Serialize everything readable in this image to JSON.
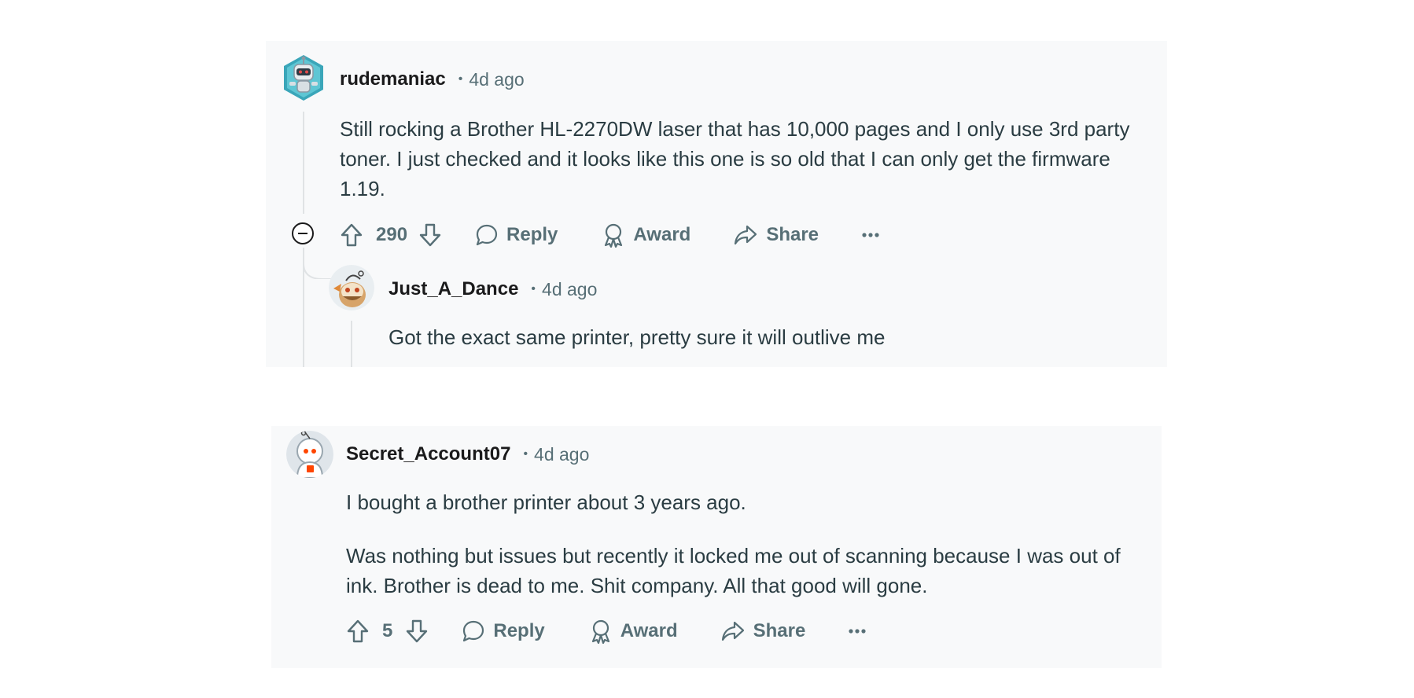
{
  "comments": [
    {
      "username": "rudemaniac",
      "separator": "•",
      "time": "4d ago",
      "body": [
        "Still rocking a Brother HL-2270DW laser that has 10,000 pages and I only use 3rd party toner. I just checked and it looks like this one is so old that I can only get the firmware 1.19."
      ],
      "score": "290",
      "actions": {
        "reply": "Reply",
        "award": "Award",
        "share": "Share"
      },
      "reply": {
        "username": "Just_A_Dance",
        "separator": "•",
        "time": "4d ago",
        "body": "Got the exact same printer, pretty sure it will outlive me"
      }
    },
    {
      "username": "Secret_Account07",
      "separator": "•",
      "time": "4d ago",
      "body": [
        "I bought a brother printer about 3 years ago.",
        "Was nothing but issues but recently it locked me out of scanning because I was out of ink. Brother is dead to me. Shit company. All that good will gone."
      ],
      "score": "5",
      "actions": {
        "reply": "Reply",
        "award": "Award",
        "share": "Share"
      }
    }
  ],
  "icons": {
    "upvote": "upvote-icon",
    "downvote": "downvote-icon",
    "reply": "speech-bubble-icon",
    "award": "award-ribbon-icon",
    "share": "share-arrow-icon",
    "more": "ellipsis-icon",
    "collapse": "collapse-minus-icon"
  },
  "colors": {
    "card_bg": "#f8f9fa",
    "meta_text": "#576f76",
    "body_text": "#2a3c42",
    "username_text": "#1a1a1b"
  }
}
